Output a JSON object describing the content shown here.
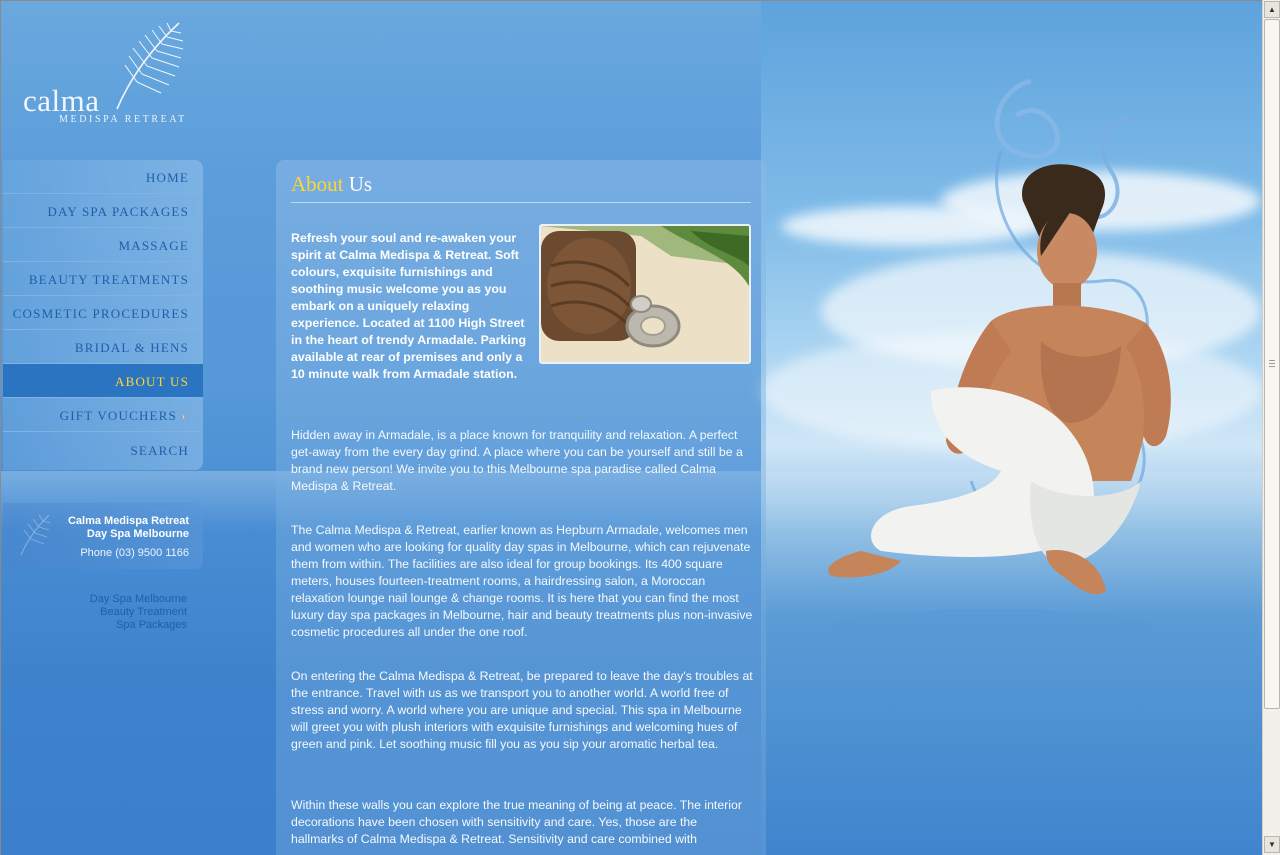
{
  "brand": {
    "name": "calma",
    "tagline": "MEDISPA RETREAT"
  },
  "nav": {
    "items": [
      {
        "label": "HOME"
      },
      {
        "label": "DAY SPA PACKAGES"
      },
      {
        "label": "MASSAGE"
      },
      {
        "label": "BEAUTY TREATMENTS"
      },
      {
        "label": "COSMETIC PROCEDURES"
      },
      {
        "label": "BRIDAL & HENS"
      },
      {
        "label": "ABOUT US"
      },
      {
        "label": "GIFT VOUCHERS"
      },
      {
        "label": "SEARCH"
      }
    ],
    "active": "ABOUT US"
  },
  "contact": {
    "line1": "Calma Medispa Retreat",
    "line2": "Day Spa Melbourne",
    "phone": "Phone (03) 9500 1166"
  },
  "seo_links": [
    "Day Spa Melbourne",
    "Beauty Treatment",
    "Spa Packages"
  ],
  "page": {
    "title_highlight": "About",
    "title_rest": "Us",
    "intro": "Refresh your soul and re-awaken your spirit at Calma Medispa & Retreat. Soft colours, exquisite furnishings and soothing music welcome you as you embark on a uniquely relaxing experience. Located at 1100 High Street in the heart of trendy Armadale. Parking available at rear of premises and only a 10 minute walk from Armadale station.",
    "paragraphs": [
      "Hidden away in Armadale, is a place known for tranquility and relaxation. A perfect get-away from the every day grind. A place where you can be yourself and still be a brand new person! We invite you to this Melbourne spa paradise called Calma Medispa & Retreat.",
      "The Calma Medispa & Retreat, earlier known as Hepburn Armadale, welcomes men and women who are looking for quality day spas in Melbourne, which can rejuvenate them from within. The facilities are also ideal for group bookings. Its 400 square meters, houses fourteen-treatment rooms, a hairdressing salon, a Moroccan relaxation lounge nail lounge & change rooms. It is here that you can find the most luxury day spa packages in Melbourne, hair and beauty treatments plus non-invasive cosmetic procedures all under the one roof.",
      "On entering the Calma Medispa & Retreat, be prepared to leave the day's troubles at the entrance. Travel with us as we transport you to another world. A world free of stress and worry. A world where you are unique and special. This spa in Melbourne will greet you with plush interiors with exquisite furnishings and welcoming hues of green and pink. Let soothing music fill you as you sip your aromatic herbal tea.",
      "Within these walls you can explore the true meaning of being at peace. The interior decorations have been chosen with sensitivity and care. Yes, those are the hallmarks of Calma Medispa & Retreat. Sensitivity and care combined with"
    ]
  },
  "colors": {
    "accent": "#ffd633",
    "nav_text": "#1f5fa8",
    "nav_active_bg": "#2a74c2",
    "background": "#4a8ed4"
  }
}
